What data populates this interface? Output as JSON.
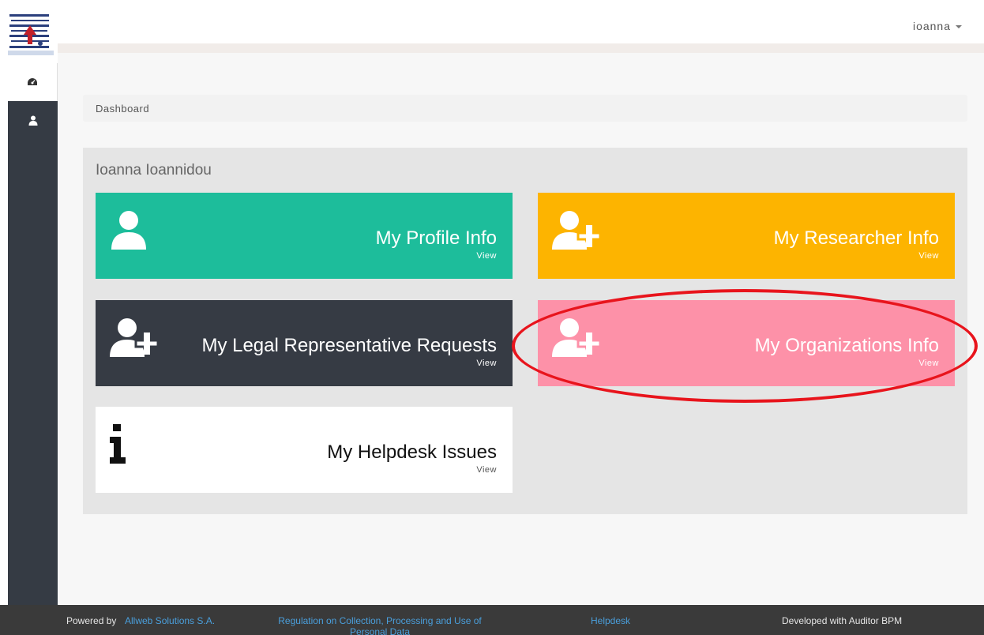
{
  "header": {
    "username": "ioanna"
  },
  "sidebar": {
    "items": [
      {
        "icon": "dashboard-icon",
        "active": true
      },
      {
        "icon": "user-icon",
        "active": false
      }
    ]
  },
  "breadcrumb": {
    "label": "Dashboard"
  },
  "panel": {
    "title": "Ioanna Ioannidou",
    "tiles": [
      {
        "title": "My Profile Info",
        "sub": "View",
        "icon": "user-icon",
        "color": "#1dbd9b"
      },
      {
        "title": "My Researcher Info",
        "sub": "View",
        "icon": "user-plus-icon",
        "color": "#fdb400"
      },
      {
        "title": "My Legal Representative Requests",
        "sub": "View",
        "icon": "user-plus-icon",
        "color": "#363b44"
      },
      {
        "title": "My Organizations Info",
        "sub": "View",
        "icon": "user-plus-icon",
        "color": "#fd91a8"
      },
      {
        "title": "My Helpdesk Issues",
        "sub": "View",
        "icon": "info-icon",
        "color": "#ffffff"
      }
    ]
  },
  "annotation": {
    "color": "#e8141c",
    "target": "My Organizations Info"
  },
  "footer": {
    "powered_by": "Powered by",
    "company": "Allweb Solutions S.A.",
    "regulation": "Regulation on Collection, Processing and Use of Personal Data",
    "helpdesk": "Helpdesk",
    "developed": "Developed with Auditor BPM"
  }
}
